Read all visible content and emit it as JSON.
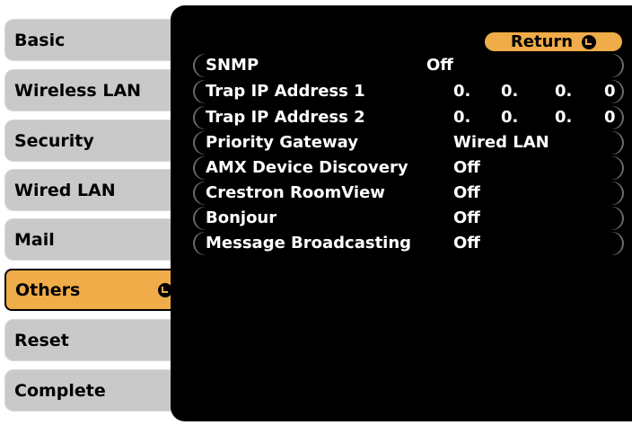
{
  "sidebar": {
    "items": [
      {
        "label": "Basic"
      },
      {
        "label": "Wireless LAN"
      },
      {
        "label": "Security"
      },
      {
        "label": "Wired LAN"
      },
      {
        "label": "Mail"
      },
      {
        "label": "Others",
        "active": true
      },
      {
        "label": "Reset"
      },
      {
        "label": "Complete"
      }
    ]
  },
  "return_button": {
    "label": "Return",
    "icon": "enter-icon"
  },
  "settings": [
    {
      "label": "SNMP",
      "value": "Off"
    },
    {
      "label": "Trap IP Address 1",
      "ip": [
        "0.",
        "0.",
        "0.",
        "0"
      ]
    },
    {
      "label": "Trap IP Address 2",
      "ip": [
        "0.",
        "0.",
        "0.",
        "0"
      ]
    },
    {
      "label": "Priority Gateway",
      "value": "Wired LAN"
    },
    {
      "label": "AMX Device Discovery",
      "value": "Off"
    },
    {
      "label": "Crestron RoomView",
      "value": "Off"
    },
    {
      "label": "Bonjour",
      "value": "Off"
    },
    {
      "label": "Message Broadcasting",
      "value": "Off"
    }
  ],
  "colors": {
    "accent": "#f0ac48",
    "tab_bg": "#c9c9c9",
    "panel_bg": "#000000"
  }
}
